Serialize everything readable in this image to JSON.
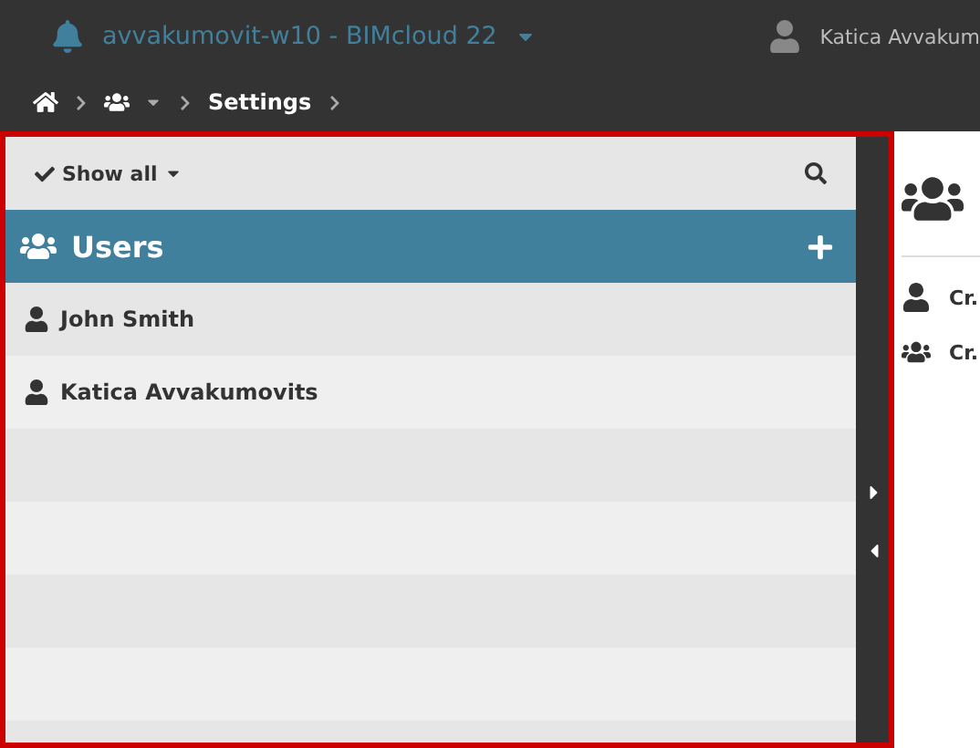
{
  "header": {
    "server_title": "avvakumovit-w10 - BIMcloud 22",
    "user_name": "Katica Avvakum"
  },
  "breadcrumb": {
    "current": "Settings"
  },
  "filter_bar": {
    "label": "Show all"
  },
  "users_panel": {
    "title": "Users",
    "users": [
      {
        "name": "John Smith"
      },
      {
        "name": "Katica Avvakumovits"
      }
    ]
  },
  "detail_panel": {
    "items": [
      {
        "kind": "user",
        "label": "Cr."
      },
      {
        "kind": "group",
        "label": "Cr."
      }
    ]
  }
}
